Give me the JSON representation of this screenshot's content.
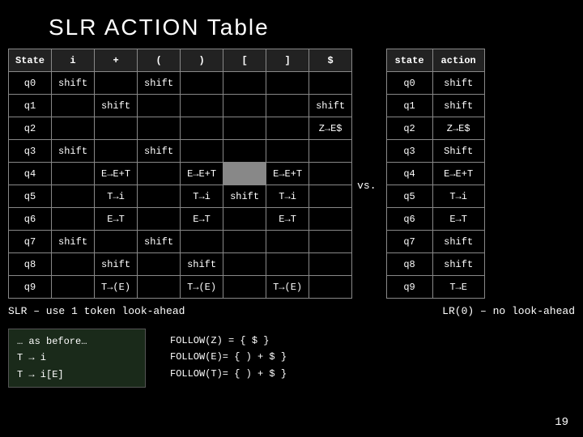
{
  "title": "SLR  ACTION  Table",
  "action_table": {
    "headers": [
      "State",
      "i",
      "+",
      "(",
      ")",
      "[",
      "]",
      "$"
    ],
    "rows": [
      [
        "q0",
        "shift",
        "",
        "shift",
        "",
        "",
        "",
        ""
      ],
      [
        "q1",
        "",
        "shift",
        "",
        "",
        "",
        "",
        "shift"
      ],
      [
        "q2",
        "",
        "",
        "",
        "",
        "",
        "",
        "Z→E$"
      ],
      [
        "q3",
        "shift",
        "",
        "shift",
        "",
        "",
        "",
        ""
      ],
      [
        "q4",
        "",
        "E→E+T",
        "",
        "E→E+T",
        "",
        "E→E+T",
        ""
      ],
      [
        "q5",
        "",
        "T→i",
        "",
        "T→i",
        "shift",
        "T→i",
        ""
      ],
      [
        "q6",
        "",
        "E→T",
        "",
        "E→T",
        "",
        "E→T",
        ""
      ],
      [
        "q7",
        "shift",
        "",
        "shift",
        "",
        "",
        "",
        ""
      ],
      [
        "q8",
        "",
        "shift",
        "",
        "shift",
        "",
        "",
        ""
      ],
      [
        "q9",
        "",
        "T→(E)",
        "",
        "T→(E)",
        "",
        "T→(E)",
        ""
      ]
    ]
  },
  "vs_label": "vs.",
  "goto_table": {
    "headers": [
      "state",
      "action"
    ],
    "rows": [
      [
        "q0",
        "shift"
      ],
      [
        "q1",
        "shift"
      ],
      [
        "q2",
        "Z→E$"
      ],
      [
        "q3",
        "Shift"
      ],
      [
        "q4",
        "E→E+T"
      ],
      [
        "q5",
        "T→i"
      ],
      [
        "q6",
        "E→T"
      ],
      [
        "q7",
        "shift"
      ],
      [
        "q8",
        "shift"
      ],
      [
        "q9",
        "T→E"
      ]
    ]
  },
  "subtitle_left": "SLR – use 1 token look-ahead",
  "subtitle_right": "LR(0) – no look-ahead",
  "grammar": [
    "…  as before…",
    "T → i",
    "T → i[E]"
  ],
  "follow": [
    "FOLLOW(Z) = { $ }",
    "FOLLOW(E)= { ) + $ }",
    "FOLLOW(T)= { ) + $ }"
  ],
  "page_number": "19"
}
